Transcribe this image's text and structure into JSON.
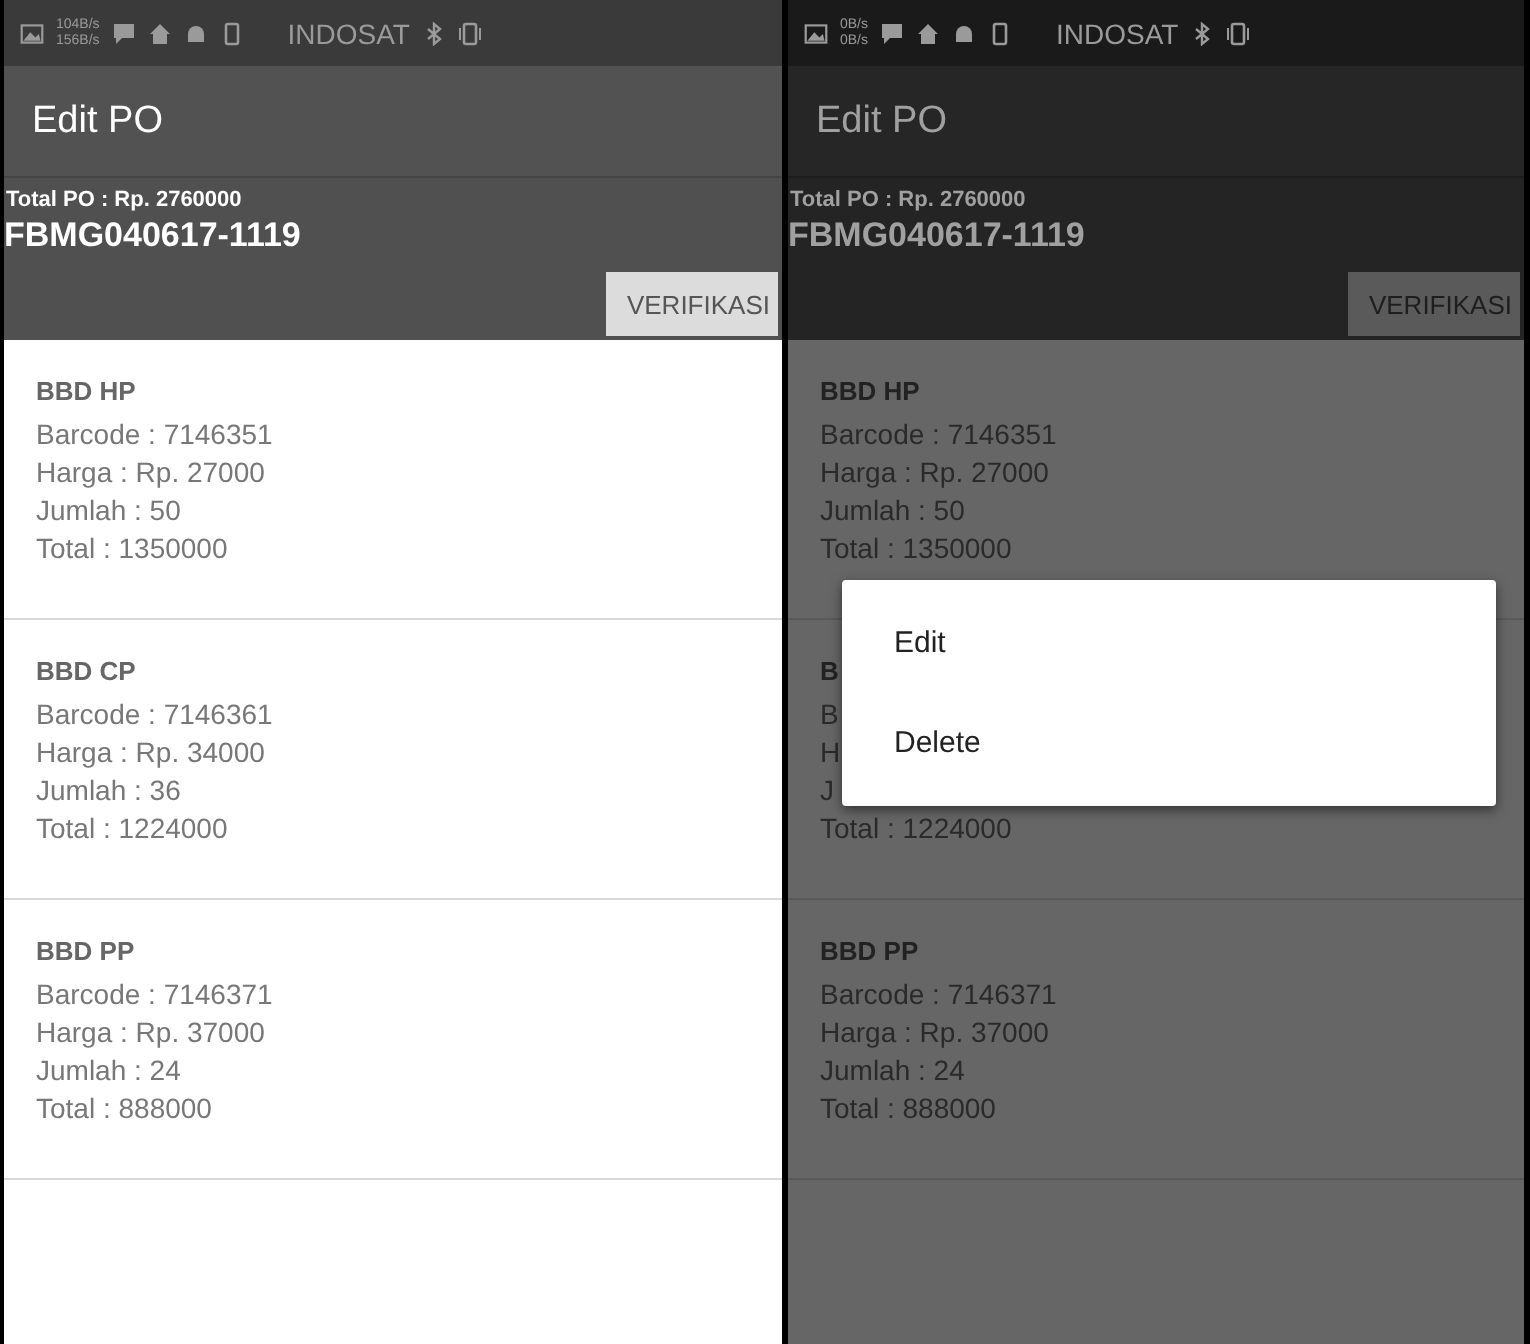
{
  "screens": [
    {
      "status_bar": {
        "speed_up": "104B/s",
        "speed_down": "156B/s",
        "carrier": "INDOSAT"
      },
      "title": "Edit PO",
      "total_po": "Total PO : Rp. 2760000",
      "po_number": "FBMG040617-1119",
      "verify_button": "VERIFIKASI",
      "dimmed": false,
      "items": [
        {
          "name": "BBD HP",
          "lines": [
            "Barcode : 7146351",
            "Harga : Rp. 27000",
            "Jumlah : 50",
            "Total : 1350000"
          ]
        },
        {
          "name": "BBD CP",
          "lines": [
            "Barcode : 7146361",
            "Harga : Rp. 34000",
            "Jumlah : 36",
            "Total : 1224000"
          ]
        },
        {
          "name": "BBD PP",
          "lines": [
            "Barcode : 7146371",
            "Harga : Rp. 37000",
            "Jumlah : 24",
            "Total : 888000"
          ]
        }
      ]
    },
    {
      "status_bar": {
        "speed_up": "0B/s",
        "speed_down": "0B/s",
        "carrier": "INDOSAT"
      },
      "title": "Edit PO",
      "total_po": "Total PO : Rp. 2760000",
      "po_number": "FBMG040617-1119",
      "verify_button": "VERIFIKASI",
      "dimmed": true,
      "items": [
        {
          "name": "BBD HP",
          "lines": [
            "Barcode : 7146351",
            "Harga : Rp. 27000",
            "Jumlah : 50",
            "Total : 1350000"
          ]
        },
        {
          "name": "B",
          "lines": [
            "B",
            "H",
            "J",
            "Total : 1224000"
          ]
        },
        {
          "name": "BBD PP",
          "lines": [
            "Barcode : 7146371",
            "Harga : Rp. 37000",
            "Jumlah : 24",
            "Total : 888000"
          ]
        }
      ],
      "context_menu": {
        "items": [
          "Edit",
          "Delete"
        ]
      }
    }
  ]
}
